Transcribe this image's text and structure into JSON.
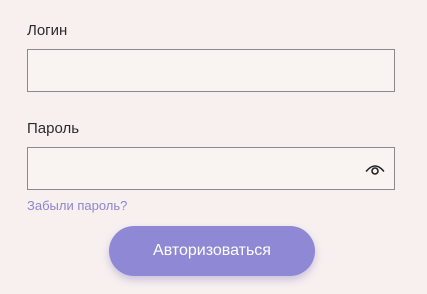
{
  "form": {
    "login_label": "Логин",
    "login_value": "",
    "password_label": "Пароль",
    "password_value": "",
    "forgot_password": "Забыли пароль?",
    "submit_label": "Авторизоваться"
  },
  "colors": {
    "background": "#f7f0ef",
    "accent": "#8e88d5",
    "link": "#8d85cf",
    "border": "#8a8a8a"
  },
  "icons": {
    "password_toggle": "eye-icon"
  }
}
